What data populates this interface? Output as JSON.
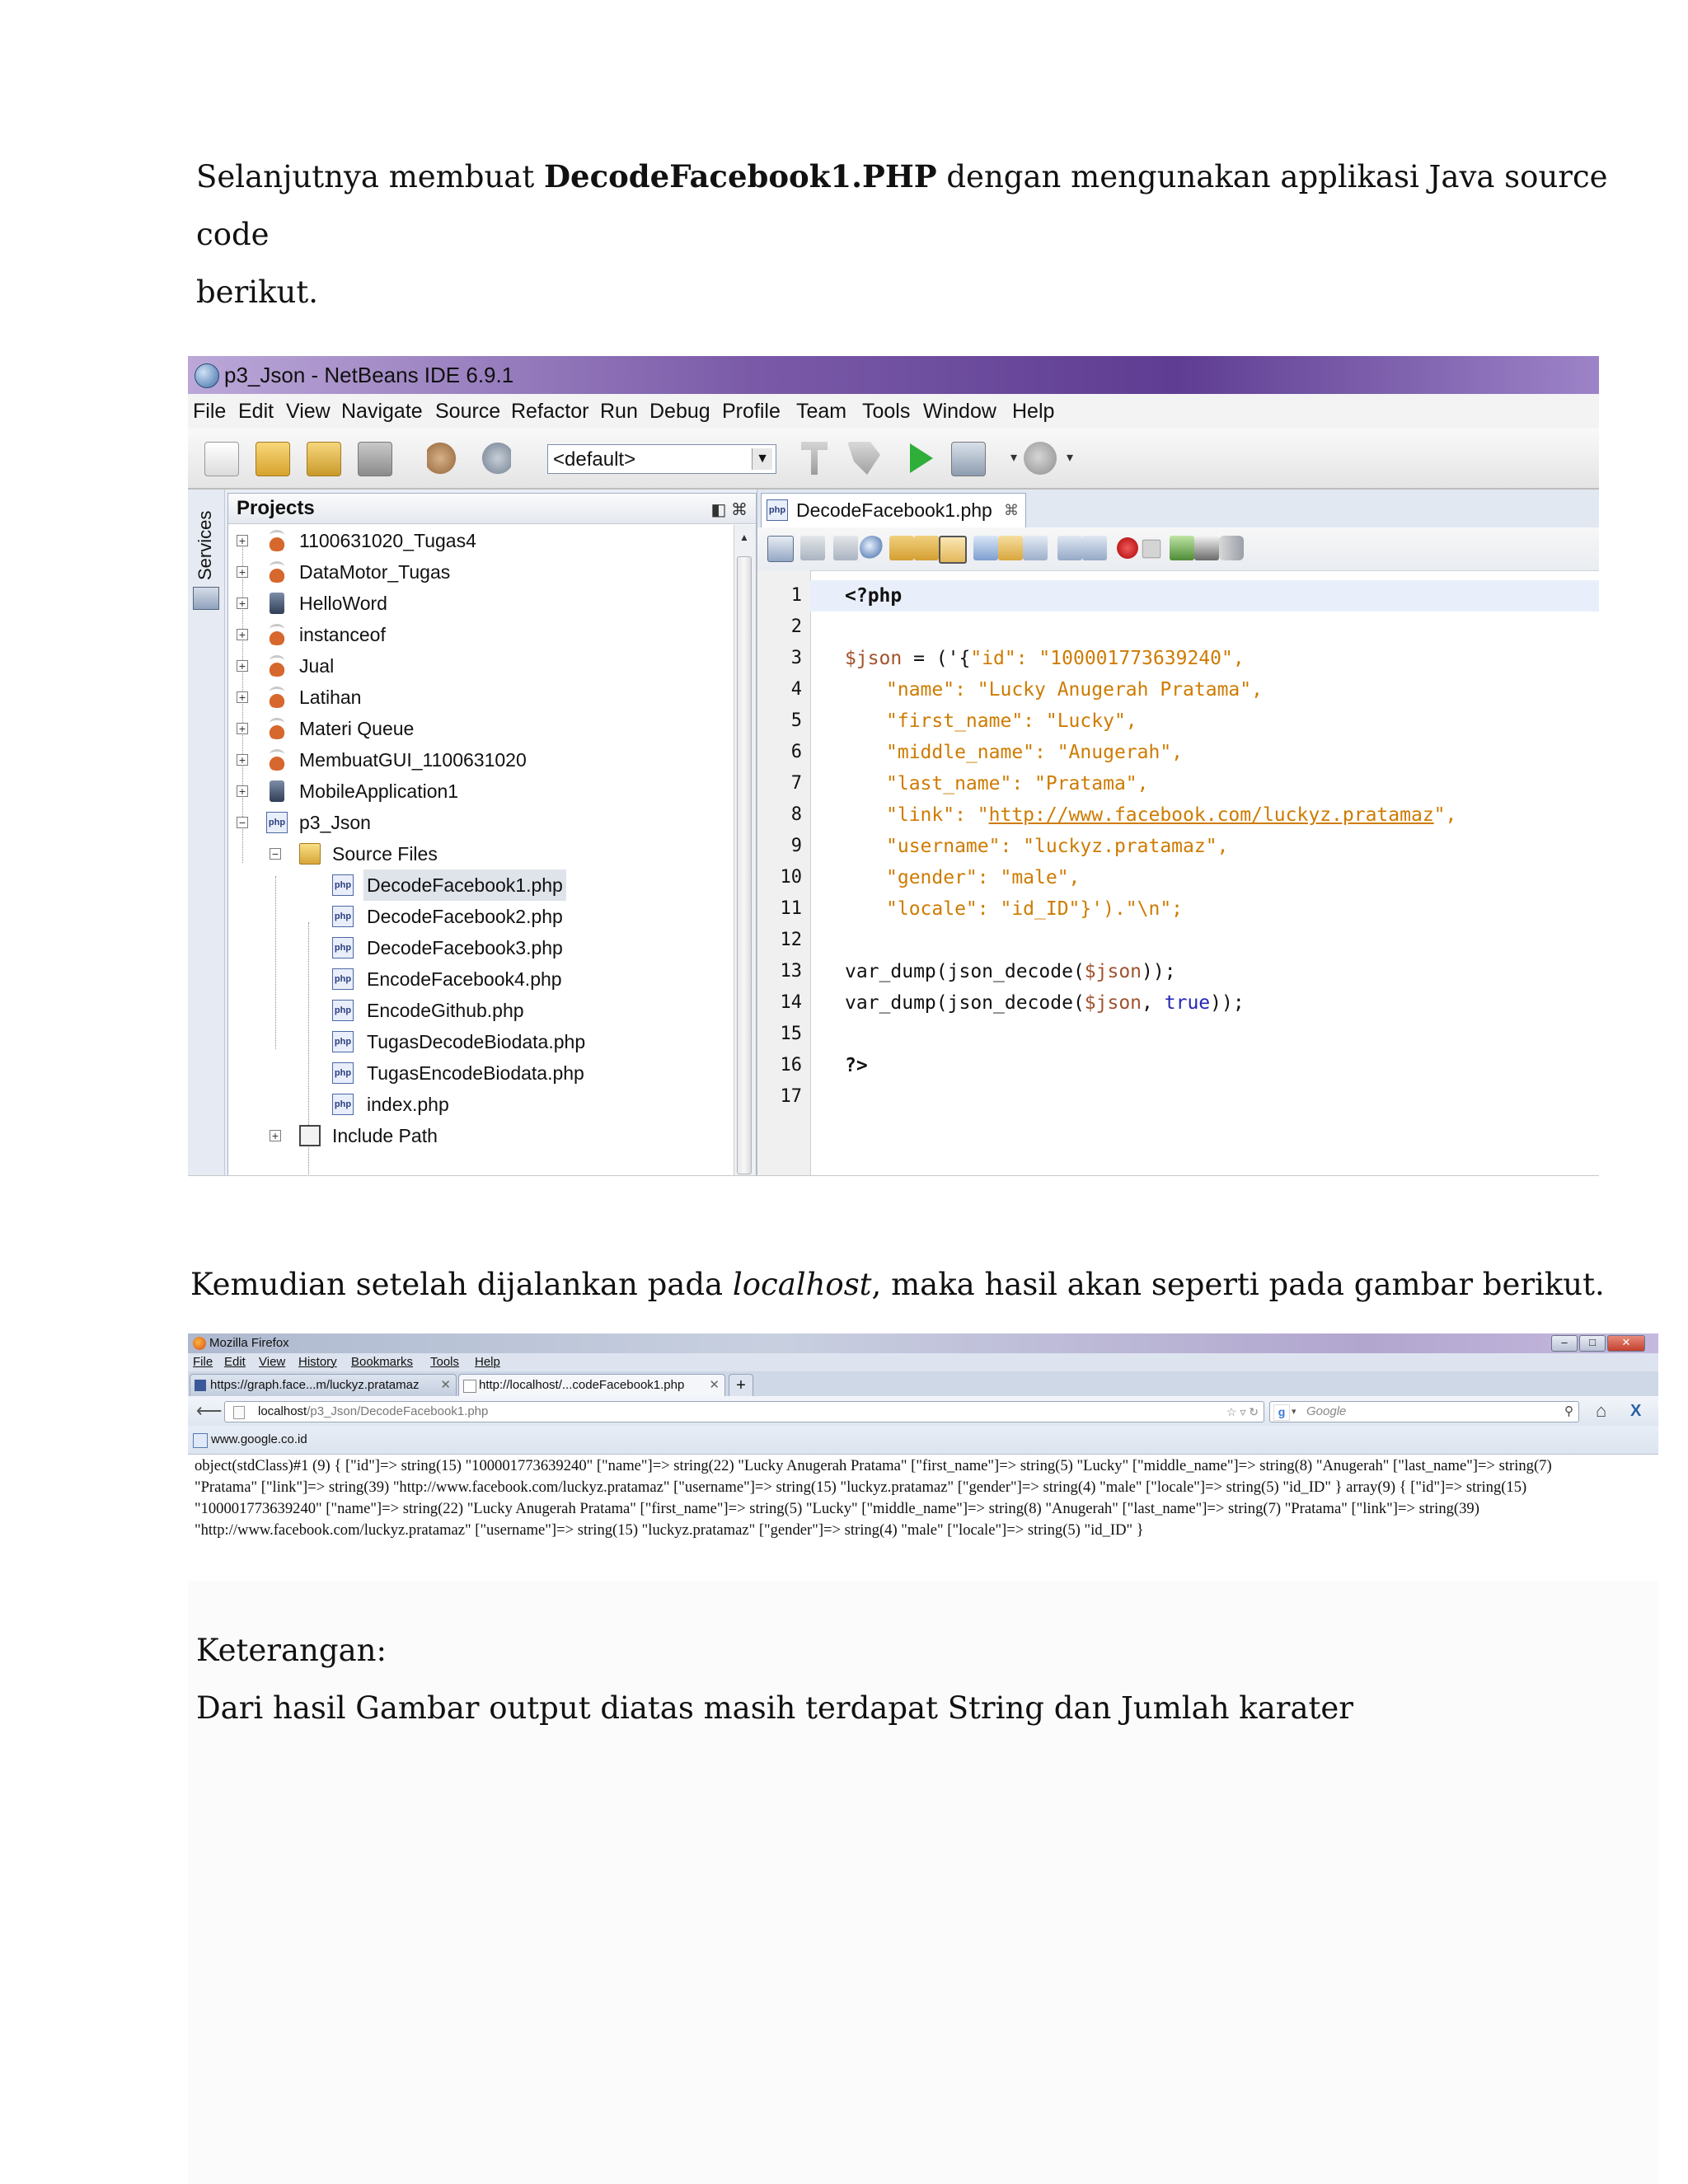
{
  "doc": {
    "para1_a": "Selanjutnya membuat ",
    "para1_b": "DecodeFacebook1.PHP",
    "para1_c": " dengan mengunakan applikasi Java source code",
    "para1_d": "berikut.",
    "para2_a": "Kemudian setelah dijalankan pada ",
    "para2_b": "localhost",
    "para2_c": ", maka hasil akan seperti pada gambar berikut.",
    "keterangan": "Keterangan:",
    "keterangan_text": "Dari hasil Gambar output diatas masih terdapat String dan Jumlah karater"
  },
  "netbeans": {
    "title": "p3_Json - NetBeans IDE 6.9.1",
    "menu": [
      "File",
      "Edit",
      "View",
      "Navigate",
      "Source",
      "Refactor",
      "Run",
      "Debug",
      "Profile",
      "Team",
      "Tools",
      "Window",
      "Help"
    ],
    "config_combo": "<default>",
    "services_label": "Services",
    "projects_header": "Projects",
    "projects": [
      {
        "label": "1100631020_Tugas4",
        "icon": "java-project-icon"
      },
      {
        "label": "DataMotor_Tugas",
        "icon": "java-project-icon"
      },
      {
        "label": "HelloWord",
        "icon": "mobile-project-icon"
      },
      {
        "label": "instanceof",
        "icon": "java-project-icon"
      },
      {
        "label": "Jual",
        "icon": "java-project-icon"
      },
      {
        "label": "Latihan",
        "icon": "java-project-icon"
      },
      {
        "label": "Materi Queue",
        "icon": "java-project-icon"
      },
      {
        "label": "MembuatGUI_1100631020",
        "icon": "java-project-icon"
      },
      {
        "label": "MobileApplication1",
        "icon": "mobile-project-icon"
      },
      {
        "label": "p3_Json",
        "icon": "php-project-icon"
      }
    ],
    "source_files_label": "Source Files",
    "files": [
      "DecodeFacebook1.php",
      "DecodeFacebook2.php",
      "DecodeFacebook3.php",
      "EncodeFacebook4.php",
      "EncodeGithub.php",
      "TugasDecodeBiodata.php",
      "TugasEncodeBiodata.php",
      "index.php"
    ],
    "include_path_label": "Include Path",
    "editor_tab": "DecodeFacebook1.php",
    "line_numbers": [
      "1",
      "2",
      "3",
      "4",
      "5",
      "6",
      "7",
      "8",
      "9",
      "10",
      "11",
      "12",
      "13",
      "14",
      "15",
      "16",
      "17"
    ],
    "code": {
      "l1": "<?php",
      "l3_var": "$json",
      "l3_op": " = ('{",
      "l3_str": "\"id\": \"100001773639240\",",
      "l4": "\"name\": \"Lucky Anugerah Pratama\",",
      "l5": "\"first_name\": \"Lucky\",",
      "l6": "\"middle_name\": \"Anugerah\",",
      "l7": "\"last_name\": \"Pratama\",",
      "l8_a": "\"link\": \"",
      "l8_url": "http://www.facebook.com/luckyz.pratamaz",
      "l8_b": "\",",
      "l9": "\"username\": \"luckyz.pratamaz\",",
      "l10": "\"gender\": \"male\",",
      "l11_a": "\"locale\": \"id_ID\"}",
      "l11_b": "').\"\\n\";",
      "l13_a": "var_dump(json_decode(",
      "l13_var": "$json",
      "l13_b": "));",
      "l14_a": "var_dump(json_decode(",
      "l14_var": "$json",
      "l14_sep": ", ",
      "l14_true": "true",
      "l14_b": "));",
      "l16": "?>"
    }
  },
  "firefox": {
    "title": "Mozilla Firefox",
    "menu": [
      "File",
      "Edit",
      "View",
      "History",
      "Bookmarks",
      "Tools",
      "Help"
    ],
    "tabs": [
      "https://graph.face...m/luckyz.pratamaz",
      "http://localhost/...codeFacebook1.php"
    ],
    "new_tab": "+",
    "url_host": "localhost",
    "url_path": "/p3_Json/DecodeFacebook1.php",
    "search_placeholder": "Google",
    "bookmark": "www.google.co.id",
    "output": [
      "object(stdClass)#1 (9) { [\"id\"]=> string(15) \"100001773639240\" [\"name\"]=> string(22) \"Lucky Anugerah Pratama\" [\"first_name\"]=> string(5) \"Lucky\" [\"middle_name\"]=> string(8) \"Anugerah\" [\"last_name\"]=> string(7)",
      "\"Pratama\" [\"link\"]=> string(39) \"http://www.facebook.com/luckyz.pratamaz\" [\"username\"]=> string(15) \"luckyz.pratamaz\" [\"gender\"]=> string(4) \"male\" [\"locale\"]=> string(5) \"id_ID\" } array(9) { [\"id\"]=> string(15)",
      "\"100001773639240\" [\"name\"]=> string(22) \"Lucky Anugerah Pratama\" [\"first_name\"]=> string(5) \"Lucky\" [\"middle_name\"]=> string(8) \"Anugerah\" [\"last_name\"]=> string(7) \"Pratama\" [\"link\"]=> string(39)",
      "\"http://www.facebook.com/luckyz.pratamaz\" [\"username\"]=> string(15) \"luckyz.pratamaz\" [\"gender\"]=> string(4) \"male\" [\"locale\"]=> string(5) \"id_ID\" }"
    ]
  }
}
